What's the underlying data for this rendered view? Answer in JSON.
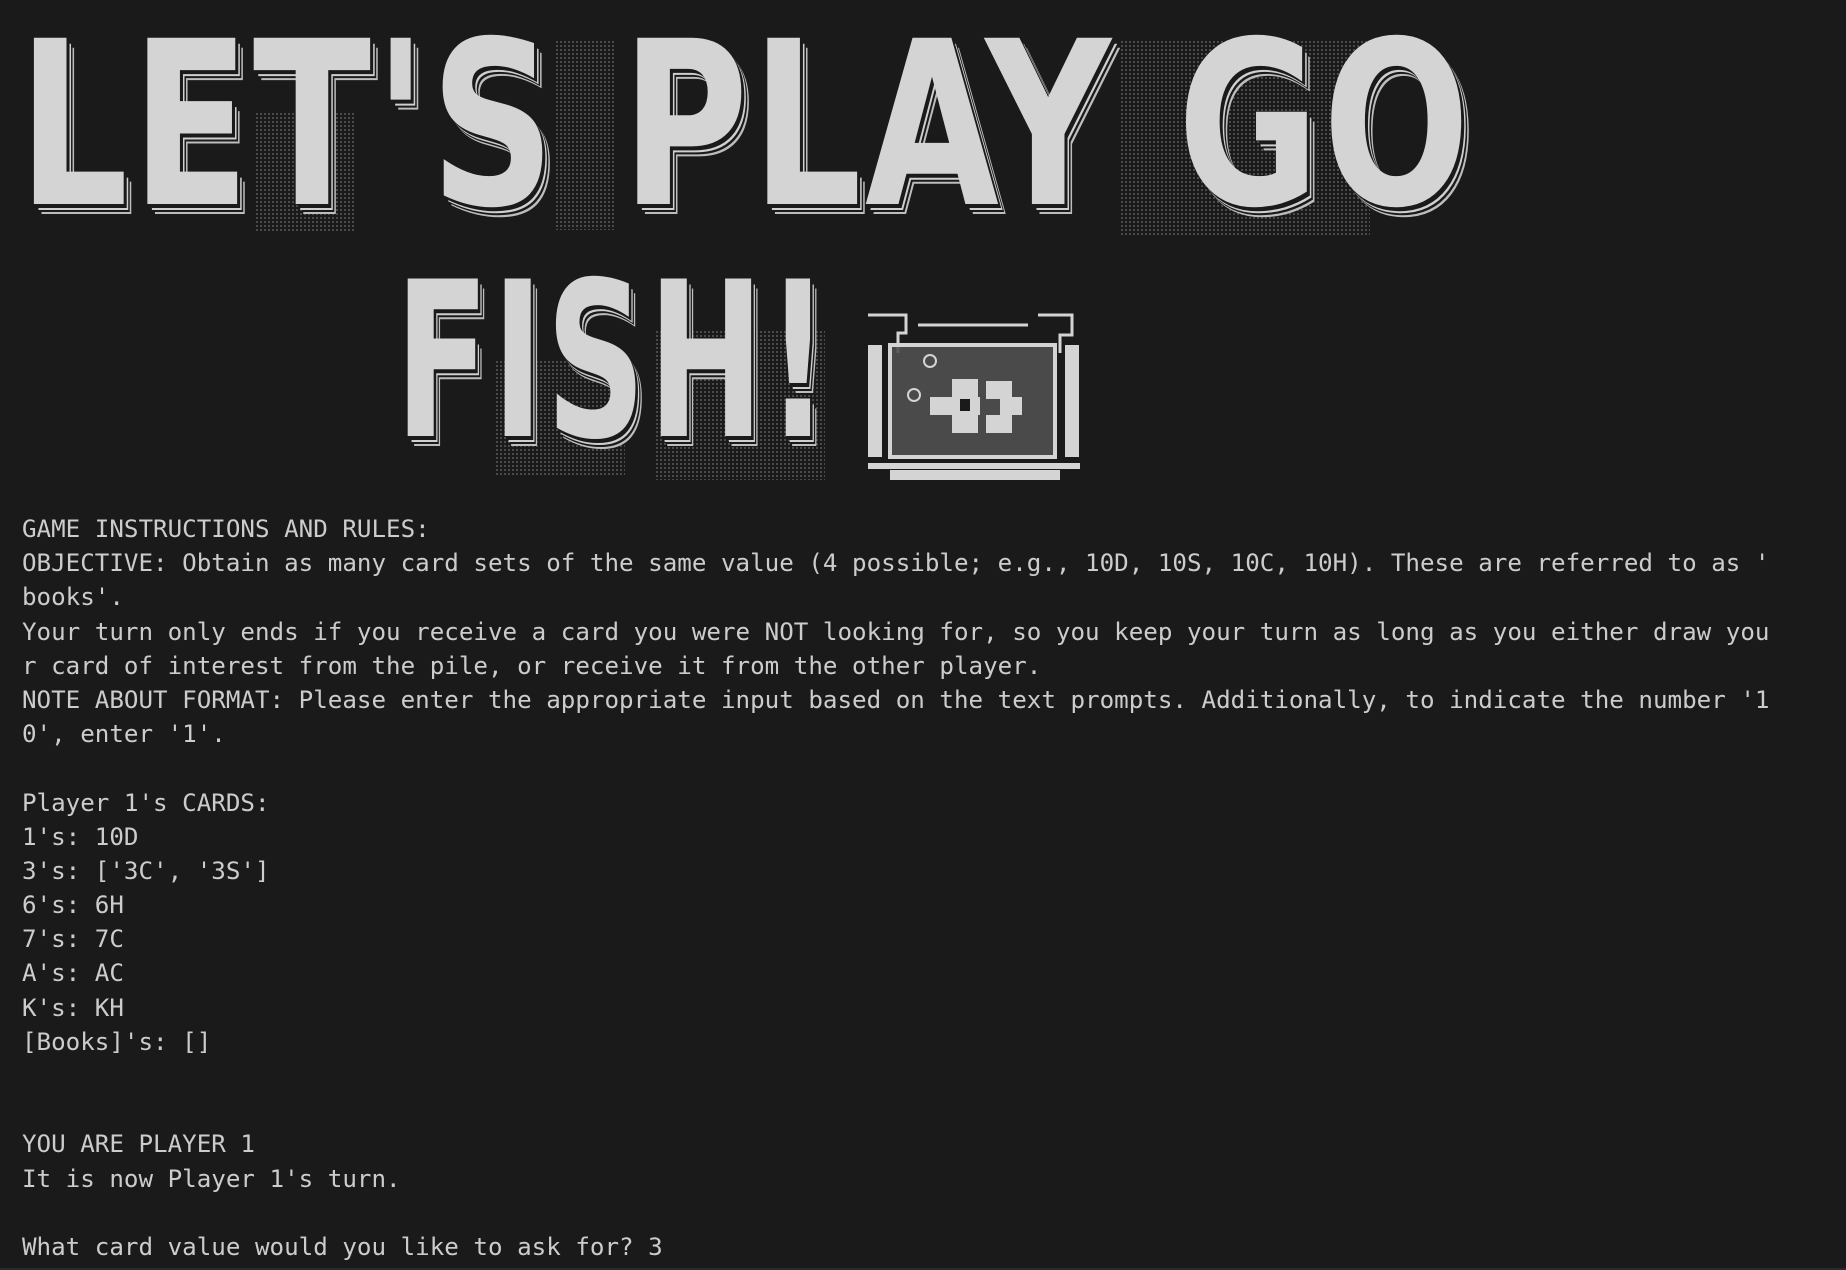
{
  "banner": {
    "line1": "LET'S PLAY GO",
    "line2": "FISH!",
    "art": "fish-bowl"
  },
  "instructions": {
    "heading": "GAME INSTRUCTIONS AND RULES:",
    "objective_1": "OBJECTIVE: Obtain as many card sets of the same value (4 possible; e.g., 10D, 10S, 10C, 10H). These are referred to as '",
    "objective_2": "books'.",
    "turn_1": "Your turn only ends if you receive a card you were NOT looking for, so you keep your turn as long as you either draw you",
    "turn_2": "r card of interest from the pile, or receive it from the other player.",
    "format_1": "NOTE ABOUT FORMAT: Please enter the appropriate input based on the text prompts. Additionally, to indicate the number '1",
    "format_2": "0', enter '1'."
  },
  "hand": {
    "title": "Player 1's CARDS:",
    "rows": [
      "1's: 10D",
      "3's: ['3C', '3S']",
      "6's: 6H",
      "7's: 7C",
      "A's: AC",
      "K's: KH",
      "[Books]'s: []"
    ]
  },
  "status": {
    "player": "YOU ARE PLAYER 1",
    "turn": "It is now Player 1's turn."
  },
  "prompt": {
    "question": "What card value would you like to ask for? 3"
  },
  "colors": {
    "background": "#1a1a1a",
    "text": "#cccccc",
    "art": "#d4d4d4"
  }
}
